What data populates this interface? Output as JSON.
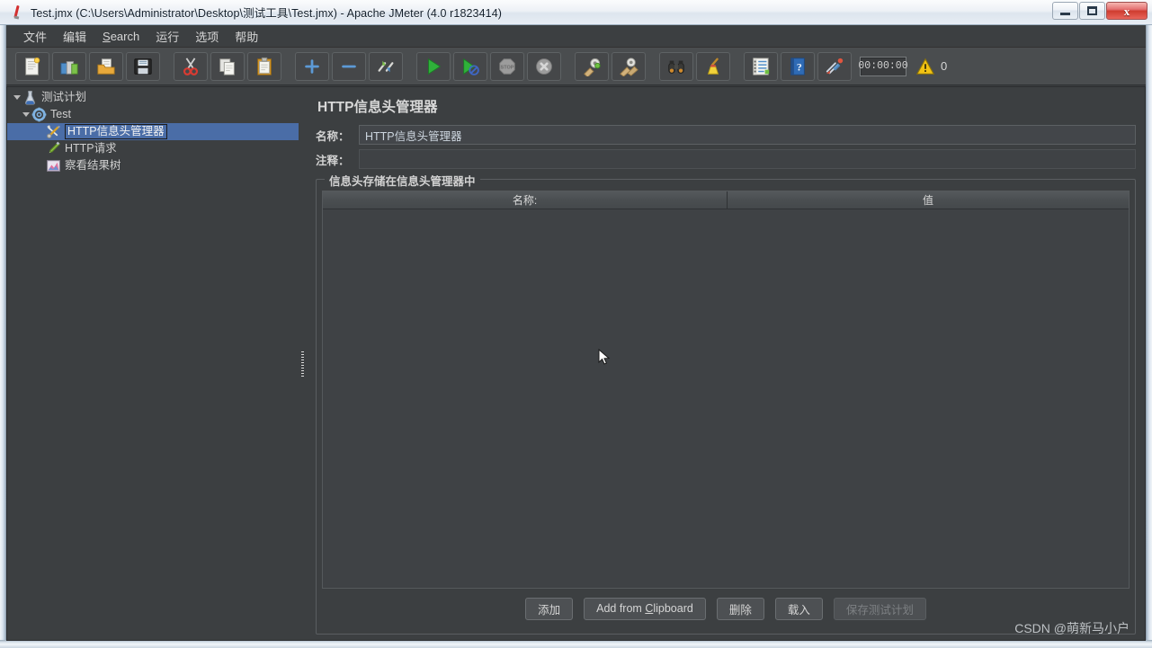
{
  "window": {
    "title": "Test.jmx (C:\\Users\\Administrator\\Desktop\\测试工具\\Test.jmx) - Apache JMeter (4.0 r1823414)",
    "app_icon": "jmeter-feather-icon",
    "controls": {
      "minimize": "minimize-button",
      "maximize": "maximize-button",
      "close_glyph": "x"
    }
  },
  "menubar": {
    "items": [
      {
        "label": "文件",
        "mnemonic": ""
      },
      {
        "label": "编辑",
        "mnemonic": ""
      },
      {
        "label": "Search",
        "mnemonic": "S"
      },
      {
        "label": "运行",
        "mnemonic": ""
      },
      {
        "label": "选项",
        "mnemonic": ""
      },
      {
        "label": "帮助",
        "mnemonic": ""
      }
    ]
  },
  "toolbar": {
    "buttons": [
      {
        "name": "new-test-plan-icon",
        "title": "新建"
      },
      {
        "name": "templates-icon",
        "title": "模板"
      },
      {
        "name": "open-icon",
        "title": "打开"
      },
      {
        "name": "save-icon",
        "title": "保存"
      },
      {
        "name": "cut-icon",
        "title": "剪切"
      },
      {
        "name": "copy-icon",
        "title": "复制"
      },
      {
        "name": "paste-icon",
        "title": "粘贴"
      },
      {
        "name": "expand-all-icon",
        "title": "展开全部"
      },
      {
        "name": "collapse-all-icon",
        "title": "折叠全部"
      },
      {
        "name": "toggle-icon",
        "title": "切换"
      },
      {
        "name": "start-icon",
        "title": "启动"
      },
      {
        "name": "start-no-pause-icon",
        "title": "无间隔启动"
      },
      {
        "name": "stop-icon",
        "title": "停止"
      },
      {
        "name": "shutdown-icon",
        "title": "关闭"
      },
      {
        "name": "clear-icon",
        "title": "清除"
      },
      {
        "name": "clear-all-icon",
        "title": "清除全部"
      },
      {
        "name": "search-icon",
        "title": "查找"
      },
      {
        "name": "reset-search-icon",
        "title": "重置查找"
      },
      {
        "name": "function-helper-icon",
        "title": "函数助手对话框"
      },
      {
        "name": "help-icon",
        "title": "帮助"
      },
      {
        "name": "undo-redo-icon",
        "title": "撤销"
      }
    ],
    "elapsed_time": "00:00:00",
    "warning_icon": "warning-triangle-icon",
    "warning_count": "0"
  },
  "tree": {
    "items": [
      {
        "label": "测试计划",
        "icon": "test-plan-icon",
        "depth": 0,
        "expanded": true,
        "selected": false
      },
      {
        "label": "Test",
        "icon": "thread-group-icon",
        "depth": 1,
        "expanded": true,
        "selected": false
      },
      {
        "label": "HTTP信息头管理器",
        "icon": "header-manager-icon",
        "depth": 2,
        "expanded": false,
        "selected": true
      },
      {
        "label": "HTTP请求",
        "icon": "http-request-icon",
        "depth": 2,
        "expanded": false,
        "selected": false
      },
      {
        "label": "察看结果树",
        "icon": "view-results-tree-icon",
        "depth": 2,
        "expanded": false,
        "selected": false
      }
    ]
  },
  "panel": {
    "title": "HTTP信息头管理器",
    "name_label": "名称：",
    "name_value": "HTTP信息头管理器",
    "comment_label": "注释：",
    "comment_value": "",
    "comment_placeholder": "",
    "groupbox_title": "信息头存储在信息头管理器中",
    "table": {
      "columns": [
        "名称:",
        "值"
      ],
      "rows": []
    },
    "buttons": [
      {
        "label": "添加",
        "mnemonic": "",
        "disabled": false,
        "name": "add-button"
      },
      {
        "label": "Add from Clipboard",
        "mnemonic": "C",
        "disabled": false,
        "name": "add-from-clipboard-button"
      },
      {
        "label": "删除",
        "mnemonic": "",
        "disabled": false,
        "name": "delete-button"
      },
      {
        "label": "载入",
        "mnemonic": "",
        "disabled": false,
        "name": "load-button"
      },
      {
        "label": "保存测试计划",
        "mnemonic": "",
        "disabled": true,
        "name": "save-test-plan-button"
      }
    ]
  },
  "watermark": "CSDN @萌新马小户",
  "colors": {
    "window_chrome": "#e8eef4",
    "client_bg": "#3c3f41",
    "toolbar_bg": "#4a4d4f",
    "selection_blue": "#4a6da7",
    "text": "#d2d2d2",
    "close_red": "#cf3c2f"
  }
}
